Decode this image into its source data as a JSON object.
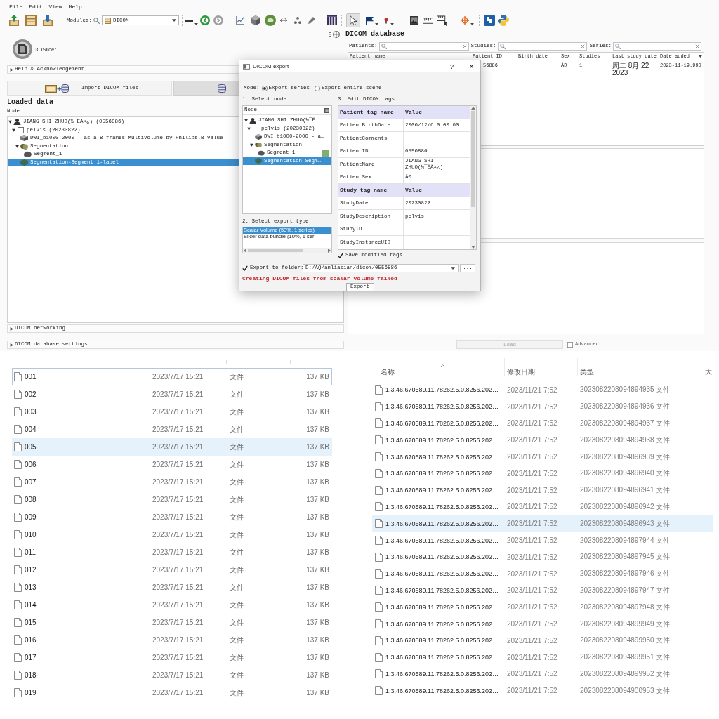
{
  "slicer": {
    "menu": [
      "File",
      "Edit",
      "View",
      "Help"
    ],
    "toolbar": {
      "modules_label": "Modules:",
      "module": "DICOM"
    },
    "logo": "3DSlicer",
    "help_section": {
      "label": "Help & Acknowledgement",
      "expanded": false
    },
    "import_button": "Import DICOM files",
    "loaded_data": {
      "title": "Loaded data",
      "column": "Node",
      "tree": [
        {
          "kind": "patient",
          "label": "JIANG SHI ZHUO(½¯ÊÀ×¿) (0556886)",
          "selected": false,
          "expanded": true,
          "children": [
            {
              "kind": "study",
              "label": "pelvis (20230822)",
              "selected": false,
              "expanded": true,
              "children": [
                {
                  "kind": "volume",
                  "label": "DWI_b1000-2000 - as a 8 frames MultiVolume by Philips.B-value",
                  "selected": false
                },
                {
                  "kind": "segmentation",
                  "label": "Segmentation",
                  "selected": false,
                  "expanded": true,
                  "children": [
                    {
                      "kind": "segment",
                      "label": "Segment_1",
                      "selected": false
                    }
                  ]
                },
                {
                  "kind": "labelmap",
                  "label": "Segmentation-Segment_1-label",
                  "selected": true
                }
              ]
            }
          ]
        }
      ]
    },
    "sections": [
      {
        "label": "DICOM networking",
        "expanded": false
      },
      {
        "label": "DICOM database settings",
        "expanded": false
      }
    ]
  },
  "database": {
    "title": "DICOM database",
    "filters": [
      {
        "label": "Patients:"
      },
      {
        "label": "Studies:"
      },
      {
        "label": "Series:"
      }
    ],
    "columns": [
      {
        "label": "Patient name",
        "sorted": false
      },
      {
        "label": "Patient ID",
        "sorted": false
      },
      {
        "label": "Birth date",
        "sorted": false
      },
      {
        "label": "Sex",
        "sorted": false
      },
      {
        "label": "Studies",
        "sorted": false
      },
      {
        "label": "Last study date",
        "sorted": false
      },
      {
        "label": "Date added",
        "sorted": true
      }
    ],
    "rows": [
      {
        "patient_id": "56886",
        "sex": "ÄÐ",
        "studies": "1",
        "last_study_date": "周二 8月 22 2023",
        "date_added": "2023-11-19.990"
      }
    ],
    "load_button": {
      "label": "Load",
      "disabled": true
    },
    "advanced": {
      "label": "Advanced",
      "checked": false
    }
  },
  "dialog": {
    "title": "DICOM export",
    "help_button": "?",
    "close_button": "×",
    "mode_label": "Mode:",
    "modes": [
      {
        "label": "Export series",
        "selected": true
      },
      {
        "label": "Export entire scene",
        "selected": false
      }
    ],
    "node_section": "1. Select node",
    "node_column": "Node",
    "tree": [
      {
        "kind": "patient",
        "label": "JIANG SHI ZHUO(½¯Ê…",
        "selected": false,
        "expanded": true,
        "children": [
          {
            "kind": "study",
            "label": "pelvis (20230822)",
            "selected": false,
            "expanded": true,
            "children": [
              {
                "kind": "volume",
                "label": "DWI_b1000-2000 - a…",
                "selected": false
              },
              {
                "kind": "segmentation",
                "label": "Segmentation",
                "selected": false,
                "expanded": true,
                "children": [
                  {
                    "kind": "segment",
                    "label": "Segment_1",
                    "selected": false,
                    "color": "#7fae72"
                  }
                ]
              },
              {
                "kind": "labelmap",
                "label": "Segmentation-Segm…",
                "selected": true
              }
            ]
          }
        ]
      }
    ],
    "type_section": "2. Select export type",
    "export_types": [
      {
        "label": "Scalar Volume (50%, 1 series)",
        "selected": true
      },
      {
        "label": "Slicer data bundle (10%, 1 ser",
        "selected": false
      }
    ],
    "tags_section": "3. Edit DICOM tags",
    "tags": [
      {
        "kind": "header",
        "name": "Patient tag name",
        "value": "Value"
      },
      {
        "kind": "tag",
        "name": "PatientBirthDate",
        "value": "2006/12/6 0:00:00"
      },
      {
        "kind": "tag",
        "name": "PatientComments"
      },
      {
        "kind": "tag",
        "name": "PatientID",
        "value": "0556886"
      },
      {
        "kind": "tag",
        "name": "PatientName",
        "value": "JIANG SHI ZHUO(½¯ÊÀ×¿)"
      },
      {
        "kind": "tag",
        "name": "PatientSex",
        "value": "ÄÐ"
      },
      {
        "kind": "header",
        "name": "Study tag name",
        "value": "Value"
      },
      {
        "kind": "tag",
        "name": "StudyDate",
        "value": "20230822"
      },
      {
        "kind": "tag",
        "name": "StudyDescription",
        "value": "pelvis"
      },
      {
        "kind": "tag",
        "name": "StudyID"
      },
      {
        "kind": "tag",
        "name": "StudyInstanceUID"
      }
    ],
    "save_modified": {
      "label": "Save modified tags",
      "checked": true
    },
    "export_folder": {
      "label": "Export to folder:",
      "checked": true,
      "value": "D:/AQ/anliasian/dicom/0556886"
    },
    "browse_button": "...",
    "error": "Creating DICOM files from scalar volume failed",
    "export_button": "Export"
  },
  "file_list_left": {
    "rows": [
      {
        "name": "001",
        "modified": "2023/7/17 15:21",
        "type": "文件",
        "size": "137 KB",
        "selected": false,
        "focused": true
      },
      {
        "name": "002",
        "modified": "2023/7/17 15:21",
        "type": "文件",
        "size": "137 KB",
        "selected": false,
        "focused": false
      },
      {
        "name": "003",
        "modified": "2023/7/17 15:21",
        "type": "文件",
        "size": "137 KB",
        "selected": false,
        "focused": false
      },
      {
        "name": "004",
        "modified": "2023/7/17 15:21",
        "type": "文件",
        "size": "137 KB",
        "selected": false,
        "focused": false
      },
      {
        "name": "005",
        "modified": "2023/7/17 15:21",
        "type": "文件",
        "size": "137 KB",
        "selected": true,
        "focused": false
      },
      {
        "name": "006",
        "modified": "2023/7/17 15:21",
        "type": "文件",
        "size": "137 KB",
        "selected": false,
        "focused": false
      },
      {
        "name": "007",
        "modified": "2023/7/17 15:21",
        "type": "文件",
        "size": "137 KB",
        "selected": false,
        "focused": false
      },
      {
        "name": "008",
        "modified": "2023/7/17 15:21",
        "type": "文件",
        "size": "137 KB",
        "selected": false,
        "focused": false
      },
      {
        "name": "009",
        "modified": "2023/7/17 15:21",
        "type": "文件",
        "size": "137 KB",
        "selected": false,
        "focused": false
      },
      {
        "name": "010",
        "modified": "2023/7/17 15:21",
        "type": "文件",
        "size": "137 KB",
        "selected": false,
        "focused": false
      },
      {
        "name": "011",
        "modified": "2023/7/17 15:21",
        "type": "文件",
        "size": "137 KB",
        "selected": false,
        "focused": false
      },
      {
        "name": "012",
        "modified": "2023/7/17 15:21",
        "type": "文件",
        "size": "137 KB",
        "selected": false,
        "focused": false
      },
      {
        "name": "013",
        "modified": "2023/7/17 15:21",
        "type": "文件",
        "size": "137 KB",
        "selected": false,
        "focused": false
      },
      {
        "name": "014",
        "modified": "2023/7/17 15:21",
        "type": "文件",
        "size": "137 KB",
        "selected": false,
        "focused": false
      },
      {
        "name": "015",
        "modified": "2023/7/17 15:21",
        "type": "文件",
        "size": "137 KB",
        "selected": false,
        "focused": false
      },
      {
        "name": "016",
        "modified": "2023/7/17 15:21",
        "type": "文件",
        "size": "137 KB",
        "selected": false,
        "focused": false
      },
      {
        "name": "017",
        "modified": "2023/7/17 15:21",
        "type": "文件",
        "size": "137 KB",
        "selected": false,
        "focused": false
      },
      {
        "name": "018",
        "modified": "2023/7/17 15:21",
        "type": "文件",
        "size": "137 KB",
        "selected": false,
        "focused": false
      },
      {
        "name": "019",
        "modified": "2023/7/17 15:21",
        "type": "文件",
        "size": "137 KB",
        "selected": false,
        "focused": false
      }
    ]
  },
  "file_list_right": {
    "columns": [
      {
        "label": "名称",
        "sorted": true
      },
      {
        "label": "修改日期",
        "sorted": false
      },
      {
        "label": "类型",
        "sorted": false
      },
      {
        "label": "大",
        "sorted": false
      }
    ],
    "rows": [
      {
        "name": "1.3.46.670589.11.78262.5.0.8256.202…",
        "modified": "2023/11/21 7:52",
        "type": "2023082208094894935 文件",
        "selected": false
      },
      {
        "name": "1.3.46.670589.11.78262.5.0.8256.202…",
        "modified": "2023/11/21 7:52",
        "type": "2023082208094894936 文件",
        "selected": false
      },
      {
        "name": "1.3.46.670589.11.78262.5.0.8256.202…",
        "modified": "2023/11/21 7:52",
        "type": "2023082208094894937 文件",
        "selected": false
      },
      {
        "name": "1.3.46.670589.11.78262.5.0.8256.202…",
        "modified": "2023/11/21 7:52",
        "type": "2023082208094894938 文件",
        "selected": false
      },
      {
        "name": "1.3.46.670589.11.78262.5.0.8256.202…",
        "modified": "2023/11/21 7:52",
        "type": "2023082208094896939 文件",
        "selected": false
      },
      {
        "name": "1.3.46.670589.11.78262.5.0.8256.202…",
        "modified": "2023/11/21 7:52",
        "type": "2023082208094896940 文件",
        "selected": false
      },
      {
        "name": "1.3.46.670589.11.78262.5.0.8256.202…",
        "modified": "2023/11/21 7:52",
        "type": "2023082208094896941 文件",
        "selected": false
      },
      {
        "name": "1.3.46.670589.11.78262.5.0.8256.202…",
        "modified": "2023/11/21 7:52",
        "type": "2023082208094896942 文件",
        "selected": false
      },
      {
        "name": "1.3.46.670589.11.78262.5.0.8256.202…",
        "modified": "2023/11/21 7:52",
        "type": "2023082208094896943 文件",
        "selected": true
      },
      {
        "name": "1.3.46.670589.11.78262.5.0.8256.202…",
        "modified": "2023/11/21 7:52",
        "type": "2023082208094897944 文件",
        "selected": false
      },
      {
        "name": "1.3.46.670589.11.78262.5.0.8256.202…",
        "modified": "2023/11/21 7:52",
        "type": "2023082208094897945 文件",
        "selected": false
      },
      {
        "name": "1.3.46.670589.11.78262.5.0.8256.202…",
        "modified": "2023/11/21 7:52",
        "type": "2023082208094897946 文件",
        "selected": false
      },
      {
        "name": "1.3.46.670589.11.78262.5.0.8256.202…",
        "modified": "2023/11/21 7:52",
        "type": "2023082208094897947 文件",
        "selected": false
      },
      {
        "name": "1.3.46.670589.11.78262.5.0.8256.202…",
        "modified": "2023/11/21 7:52",
        "type": "2023082208094897948 文件",
        "selected": false
      },
      {
        "name": "1.3.46.670589.11.78262.5.0.8256.202…",
        "modified": "2023/11/21 7:52",
        "type": "2023082208094899949 文件",
        "selected": false
      },
      {
        "name": "1.3.46.670589.11.78262.5.0.8256.202…",
        "modified": "2023/11/21 7:52",
        "type": "2023082208094899950 文件",
        "selected": false
      },
      {
        "name": "1.3.46.670589.11.78262.5.0.8256.202…",
        "modified": "2023/11/21 7:52",
        "type": "2023082208094899951 文件",
        "selected": false
      },
      {
        "name": "1.3.46.670589.11.78262.5.0.8256.202…",
        "modified": "2023/11/21 7:52",
        "type": "2023082208094899952 文件",
        "selected": false
      },
      {
        "name": "1.3.46.670589.11.78262.5.0.8256.202…",
        "modified": "2023/11/21 7:52",
        "type": "2023082208094900953 文件",
        "selected": false
      }
    ]
  }
}
